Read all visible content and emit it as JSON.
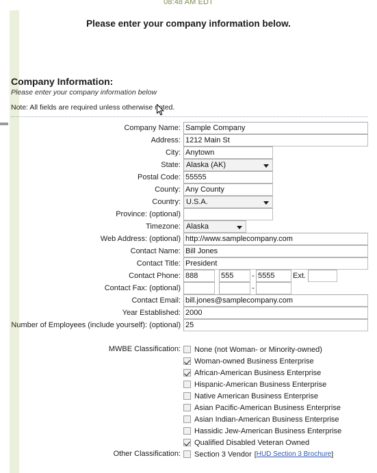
{
  "header": {
    "timestamp": "08:48 AM EDT",
    "page_title": "Please enter your company information below."
  },
  "section": {
    "heading": "Company Information:",
    "subtitle": "Please enter your company information below",
    "note": "Note: All fields are required unless otherwise noted."
  },
  "fields": {
    "company_name": {
      "label": "Company Name:",
      "value": "Sample Company"
    },
    "address": {
      "label": "Address:",
      "value": "1212 Main St"
    },
    "city": {
      "label": "City:",
      "value": "Anytown"
    },
    "state": {
      "label": "State:",
      "value": "Alaska (AK)"
    },
    "postal_code": {
      "label": "Postal Code:",
      "value": "55555"
    },
    "county": {
      "label": "County:",
      "value": "Any County"
    },
    "country": {
      "label": "Country:",
      "value": "U.S.A."
    },
    "province": {
      "label": "Province: (optional)",
      "value": ""
    },
    "timezone": {
      "label": "Timezone:",
      "value": "Alaska"
    },
    "web_address": {
      "label": "Web Address: (optional)",
      "value": "http://www.samplecompany.com"
    },
    "contact_name": {
      "label": "Contact Name:",
      "value": "Bill Jones"
    },
    "contact_title": {
      "label": "Contact Title:",
      "value": "President"
    },
    "contact_phone": {
      "label": "Contact Phone:",
      "area": "888",
      "prefix": "555",
      "line": "5555",
      "ext_label": "Ext.",
      "ext": "",
      "separator": "-"
    },
    "contact_fax": {
      "label": "Contact Fax: (optional)",
      "area": "",
      "prefix": "",
      "line": "",
      "separator": "-"
    },
    "contact_email": {
      "label": "Contact Email:",
      "value": "bill.jones@samplecompany.com"
    },
    "year_established": {
      "label": "Year Established:",
      "value": "2000"
    },
    "employees": {
      "label": "Number of Employees (include yourself): (optional)",
      "value": "25"
    }
  },
  "mwbe": {
    "label": "MWBE Classification:",
    "options": [
      {
        "text": "None (not Woman- or Minority-owned)",
        "checked": false
      },
      {
        "text": "Woman-owned Business Enterprise",
        "checked": true
      },
      {
        "text": "African-American Business Enterprise",
        "checked": true
      },
      {
        "text": "Hispanic-American Business Enterprise",
        "checked": false
      },
      {
        "text": "Native American Business Enterprise",
        "checked": false
      },
      {
        "text": "Asian Pacific-American Business Enterprise",
        "checked": false
      },
      {
        "text": "Asian Indian-American Business Enterprise",
        "checked": false
      },
      {
        "text": "Hassidic Jew-American Business Enterprise",
        "checked": false
      },
      {
        "text": "Qualified Disabled Veteran Owned",
        "checked": true
      }
    ]
  },
  "other_classification": {
    "label": "Other Classification:",
    "option_text": "Section 3 Vendor",
    "checked": false,
    "link_text": "HUD Section 3 Brochure",
    "bracket_open": "[",
    "bracket_close": "]"
  },
  "colors": {
    "stripe": "#ebf0dc",
    "timestamp": "#7b8c52",
    "link": "#2f59b0",
    "input_border": "#a9a9a9",
    "select_bg": "#f2f2f2"
  }
}
